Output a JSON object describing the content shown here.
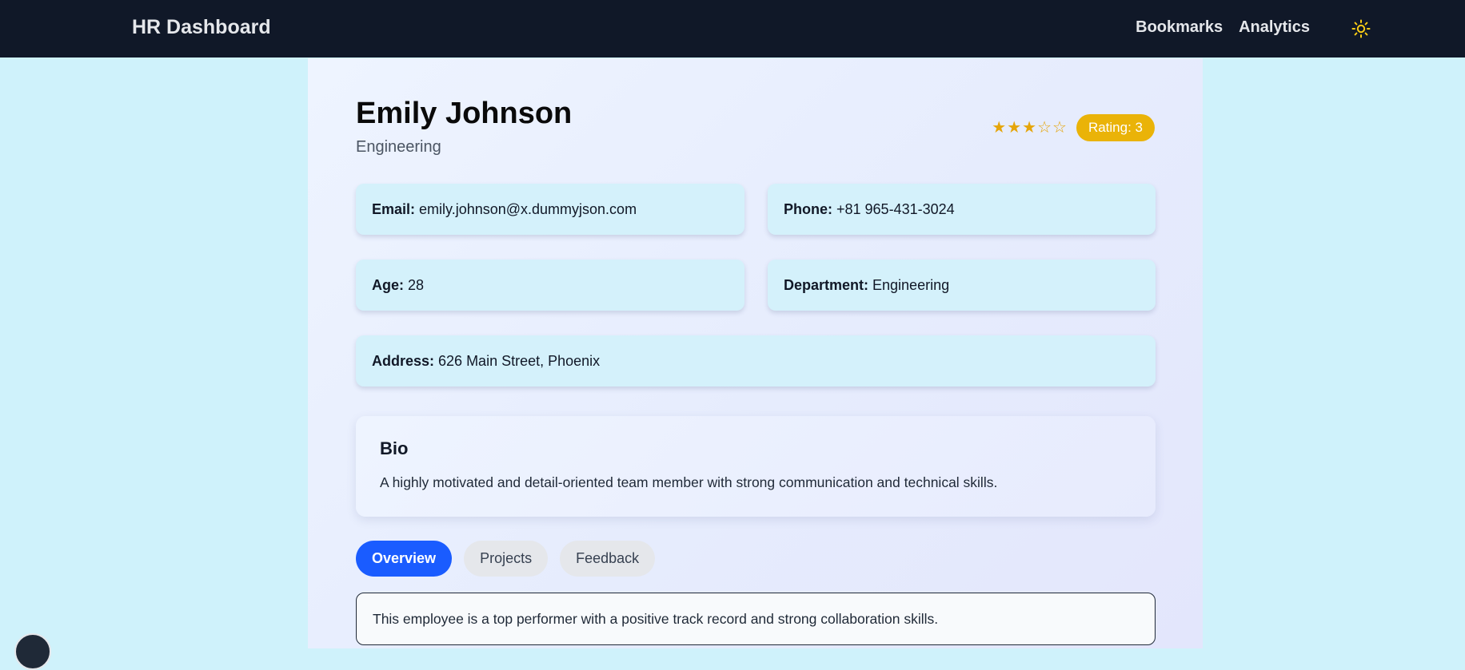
{
  "navbar": {
    "brand": "HR Dashboard",
    "links": [
      "Bookmarks",
      "Analytics"
    ],
    "theme_icon": "sun-icon"
  },
  "employee": {
    "name": "Emily Johnson",
    "department": "Engineering",
    "rating_value": 3,
    "rating_max": 5,
    "rating_label": "Rating: 3",
    "stars": [
      "★",
      "★",
      "★",
      "☆",
      "☆"
    ]
  },
  "info": {
    "email_label": "Email:",
    "email": "emily.johnson@x.dummyjson.com",
    "phone_label": "Phone:",
    "phone": "+81 965-431-3024",
    "age_label": "Age:",
    "age": "28",
    "department_label": "Department:",
    "department": "Engineering",
    "address_label": "Address:",
    "address": "626 Main Street, Phoenix"
  },
  "bio": {
    "title": "Bio",
    "text": "A highly motivated and detail-oriented team member with strong communication and technical skills."
  },
  "tabs": [
    {
      "label": "Overview",
      "active": true
    },
    {
      "label": "Projects",
      "active": false
    },
    {
      "label": "Feedback",
      "active": false
    }
  ],
  "tab_content": {
    "text": "This employee is a top performer with a positive track record and strong collaboration skills."
  },
  "colors": {
    "navbar_bg": "#101828",
    "page_bg": "#cff2fb",
    "card_bg": "#d4f1fb",
    "accent_blue": "#1a5cff",
    "rating_badge": "#eab308",
    "star": "#e5a50a",
    "sun_icon": "#facc15"
  }
}
